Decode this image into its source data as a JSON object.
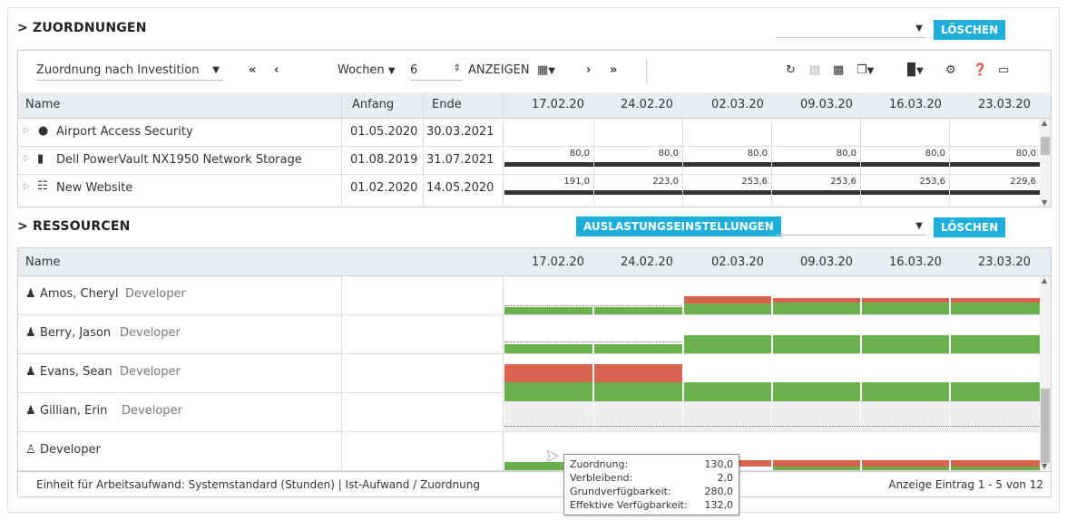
{
  "assignments": {
    "title": "ZUORDNUNGEN",
    "delete_label": "LÖSCHEN",
    "toolbar": {
      "assignment_mode": "Zuordnung nach Investition",
      "weeks_label": "Wochen",
      "weeks_value": "6",
      "show_label": "ANZEIGEN"
    },
    "columns": {
      "name": "Name",
      "start": "Anfang",
      "end": "Ende"
    },
    "dates": [
      "17.02.20",
      "24.02.20",
      "02.03.20",
      "09.03.20",
      "16.03.20",
      "23.03.20"
    ],
    "rows": [
      {
        "name": "Airport Access Security",
        "icon": "lightbulb-icon",
        "start": "01.05.2020",
        "end": "30.03.2021",
        "values": [
          "",
          "",
          "",
          "",
          "",
          ""
        ]
      },
      {
        "name": "Dell PowerVault NX1950 Network Storage",
        "icon": "server-icon",
        "start": "01.08.2019",
        "end": "31.07.2021",
        "values": [
          "80,0",
          "80,0",
          "80,0",
          "80,0",
          "80,0",
          "80,0"
        ]
      },
      {
        "name": "New Website",
        "icon": "network-icon",
        "start": "01.02.2020",
        "end": "14.05.2020",
        "values": [
          "191,0",
          "223,0",
          "253,6",
          "253,6",
          "253,6",
          "229,6"
        ]
      }
    ]
  },
  "resources": {
    "title": "RESSOURCEN",
    "settings_label": "AUSLASTUNGSEINSTELLUNGEN",
    "delete_label": "LÖSCHEN",
    "columns": {
      "name": "Name"
    },
    "dates": [
      "17.02.20",
      "24.02.20",
      "02.03.20",
      "09.03.20",
      "16.03.20",
      "23.03.20"
    ],
    "rows": [
      {
        "name": "Amos, Cheryl",
        "role": "Developer",
        "icon": "user-icon"
      },
      {
        "name": "Berry, Jason",
        "role": "Developer",
        "icon": "user-icon"
      },
      {
        "name": "Evans, Sean",
        "role": "Developer",
        "icon": "user-icon"
      },
      {
        "name": "Gillian, Erin",
        "role": "Developer",
        "icon": "user-icon"
      },
      {
        "name": "",
        "role": "Developer",
        "icon": "user-outline-icon"
      }
    ],
    "footer_left": "Einheit für Arbeitsaufwand: Systemstandard (Stunden) | Ist-Aufwand / Zuordnung",
    "footer_right": "Anzeige Eintrag 1 - 5 von 12"
  },
  "tooltip": {
    "rows": [
      {
        "label": "Zuordnung:",
        "value": "130,0"
      },
      {
        "label": "Verbleibend:",
        "value": "2,0"
      },
      {
        "label": "Grundverfügbarkeit:",
        "value": "280,0"
      },
      {
        "label": "Effektive Verfügbarkeit:",
        "value": "132,0"
      }
    ]
  },
  "colors": {
    "accent": "#1eaedb",
    "available": "#6ab04c",
    "overload": "#d9634f",
    "header_bg": "#e9edf2"
  }
}
